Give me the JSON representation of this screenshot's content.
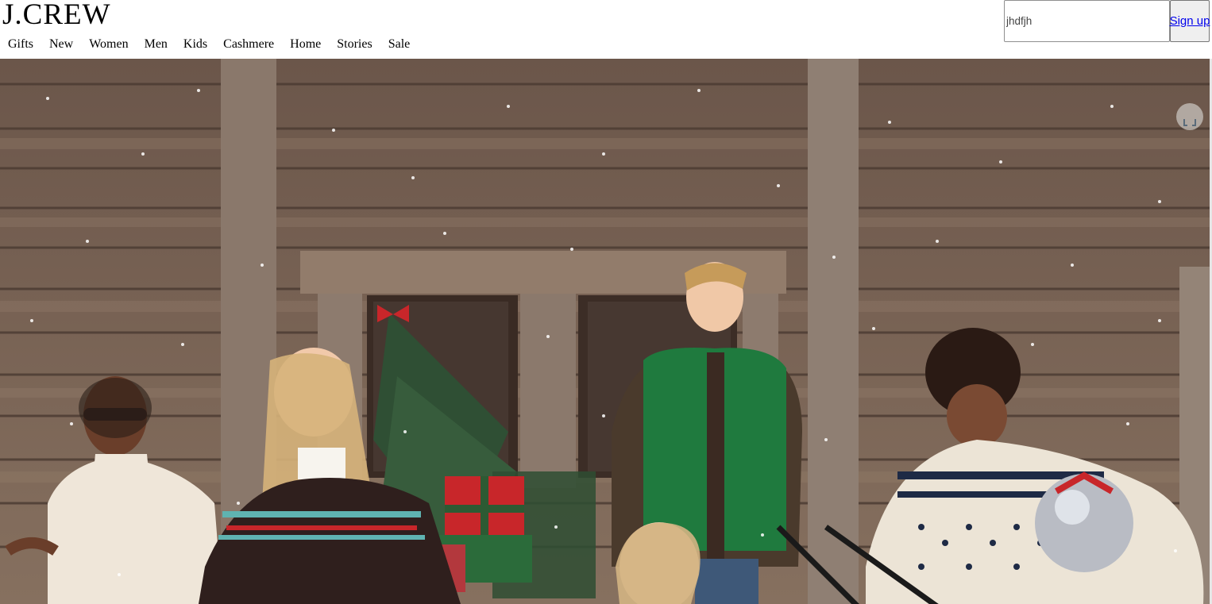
{
  "header": {
    "logo_text": "J.CREW",
    "nav": [
      {
        "label": "Gifts"
      },
      {
        "label": "New"
      },
      {
        "label": "Women"
      },
      {
        "label": "Men"
      },
      {
        "label": "Kids"
      },
      {
        "label": "Cashmere"
      },
      {
        "label": "Home"
      },
      {
        "label": "Stories"
      },
      {
        "label": "Sale"
      }
    ],
    "search": {
      "value": "jhdfjh"
    },
    "signup_label": "Sign up"
  },
  "hero": {
    "icon": "expand-icon",
    "colors": {
      "wood": "#7a6556",
      "vest_green": "#1f7a3e",
      "gift_red": "#c8262a"
    }
  }
}
